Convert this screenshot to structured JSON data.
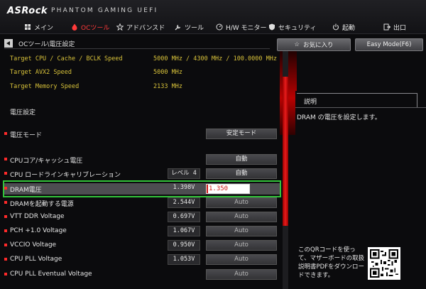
{
  "header": {
    "brand": "ASRock",
    "product": "PHANTOM GAMING UEFI",
    "nav": [
      {
        "label": "メイン",
        "icon": "grid-icon"
      },
      {
        "label": "OCツール",
        "icon": "flame-icon",
        "active": true
      },
      {
        "label": "アドバンスド",
        "icon": "star-icon"
      },
      {
        "label": "ツール",
        "icon": "wrench-icon"
      },
      {
        "label": "H/W モニター",
        "icon": "monitor-icon"
      },
      {
        "label": "セキュリティ",
        "icon": "shield-icon"
      },
      {
        "label": "起動",
        "icon": "power-icon"
      },
      {
        "label": "出口",
        "icon": "exit-icon"
      }
    ]
  },
  "breadcrumb": "OCツール\\電圧設定",
  "info": [
    {
      "label": "Target CPU / Cache / BCLK Speed",
      "value": "5000 MHz / 4300 MHz / 100.0000 MHz"
    },
    {
      "label": "Target AVX2 Speed",
      "value": "5000 MHz"
    },
    {
      "label": "Target Memory Speed",
      "value": "2133 MHz"
    }
  ],
  "section_title": "電圧設定",
  "settings": [
    {
      "label": "電圧モード",
      "current": "",
      "option": "安定モード"
    },
    {
      "label": "CPUコア/キャッシュ電圧",
      "current": "",
      "option": "自動"
    },
    {
      "label": "CPU ロードラインキャリブレーション",
      "current": "レベル 4",
      "option": "自動"
    },
    {
      "label": "DRAM電圧",
      "current": "1.398V",
      "option": "1.350",
      "selected": true
    },
    {
      "label": "DRAMを起動する電源",
      "current": "2.544V",
      "option": "Auto"
    },
    {
      "label": "VTT DDR Voltage",
      "current": "0.697V",
      "option": "Auto"
    },
    {
      "label": "PCH +1.0 Voltage",
      "current": "1.067V",
      "option": "Auto"
    },
    {
      "label": "VCCIO Voltage",
      "current": "0.950V",
      "option": "Auto"
    },
    {
      "label": "CPU PLL Voltage",
      "current": "1.053V",
      "option": "Auto"
    },
    {
      "label": "CPU PLL Eventual Voltage",
      "current": "",
      "option": "Auto"
    }
  ],
  "right": {
    "favorites_label": "お気に入り",
    "easy_mode_label": "Easy Mode(F6)",
    "panel_title": "説明",
    "description": "DRAM の電圧を設定します。",
    "qr_text": "このQRコードを使って、マザーボードの取扱説明書PDFをダウンロードできます。"
  },
  "colors": {
    "accent_red": "#e81c1c",
    "info_yellow": "#d8c23a",
    "highlight_green": "#32c43a"
  }
}
